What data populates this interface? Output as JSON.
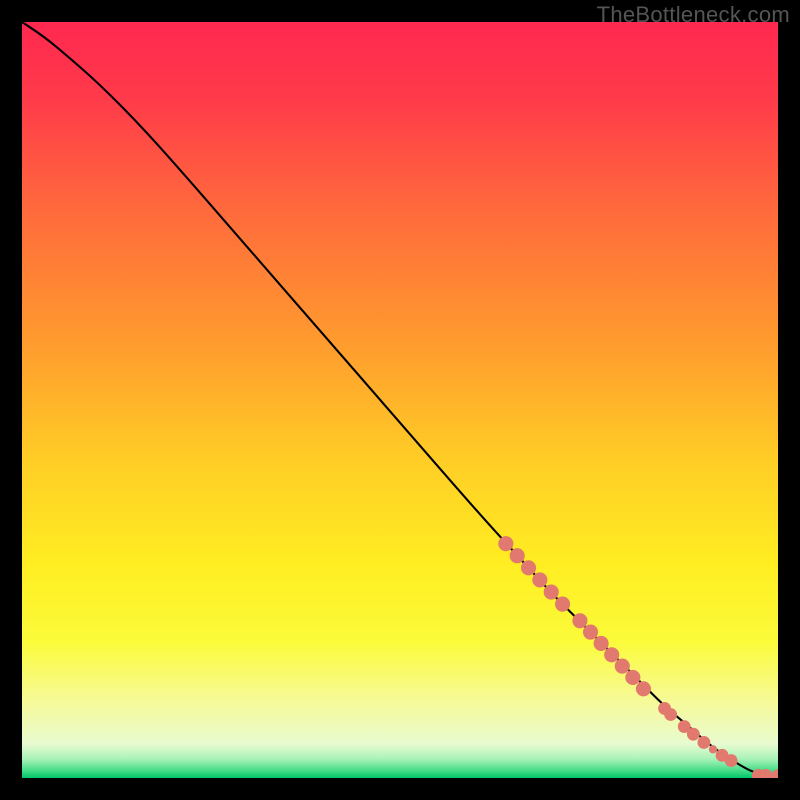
{
  "watermark": "TheBottleneck.com",
  "gradient": {
    "stops": [
      {
        "offset": 0.0,
        "color": "#ff2850"
      },
      {
        "offset": 0.1,
        "color": "#ff3a4a"
      },
      {
        "offset": 0.25,
        "color": "#ff6a3c"
      },
      {
        "offset": 0.42,
        "color": "#ff9a2e"
      },
      {
        "offset": 0.58,
        "color": "#ffcd26"
      },
      {
        "offset": 0.72,
        "color": "#ffee22"
      },
      {
        "offset": 0.82,
        "color": "#fbfb3a"
      },
      {
        "offset": 0.9,
        "color": "#f6fa9a"
      },
      {
        "offset": 0.955,
        "color": "#e8fbd0"
      },
      {
        "offset": 0.975,
        "color": "#a8f2b8"
      },
      {
        "offset": 0.99,
        "color": "#46dd88"
      },
      {
        "offset": 1.0,
        "color": "#00c46a"
      }
    ]
  },
  "chart_data": {
    "type": "line",
    "title": "",
    "xlabel": "",
    "ylabel": "",
    "xlim": [
      0,
      100
    ],
    "ylim": [
      0,
      100
    ],
    "series": [
      {
        "name": "curve",
        "x": [
          0,
          3,
          6,
          10,
          15,
          20,
          30,
          40,
          50,
          60,
          65,
          70,
          73,
          76,
          79,
          82,
          85,
          88,
          90,
          92,
          94,
          95.5,
          96.5,
          97.5,
          98.5,
          100
        ],
        "y": [
          100,
          98,
          95.5,
          92,
          87,
          81.5,
          70,
          58.5,
          47,
          35.5,
          30,
          24.5,
          21.5,
          18.5,
          15.5,
          12.5,
          9.5,
          7,
          5.2,
          3.6,
          2.3,
          1.4,
          0.9,
          0.55,
          0.35,
          0.3
        ],
        "color": "#000000",
        "width": 2
      }
    ],
    "markers": [
      {
        "x": 64.0,
        "y": 31.0,
        "r": 1.0
      },
      {
        "x": 65.5,
        "y": 29.4,
        "r": 1.0
      },
      {
        "x": 67.0,
        "y": 27.8,
        "r": 1.0
      },
      {
        "x": 68.5,
        "y": 26.2,
        "r": 1.0
      },
      {
        "x": 70.0,
        "y": 24.6,
        "r": 1.0
      },
      {
        "x": 71.5,
        "y": 23.0,
        "r": 1.0
      },
      {
        "x": 73.8,
        "y": 20.8,
        "r": 1.0
      },
      {
        "x": 75.2,
        "y": 19.3,
        "r": 1.0
      },
      {
        "x": 76.6,
        "y": 17.8,
        "r": 1.0
      },
      {
        "x": 78.0,
        "y": 16.3,
        "r": 1.0
      },
      {
        "x": 79.4,
        "y": 14.8,
        "r": 1.0
      },
      {
        "x": 80.8,
        "y": 13.3,
        "r": 1.0
      },
      {
        "x": 82.2,
        "y": 11.8,
        "r": 1.0
      },
      {
        "x": 85.0,
        "y": 9.2,
        "r": 0.85
      },
      {
        "x": 85.8,
        "y": 8.4,
        "r": 0.85
      },
      {
        "x": 87.6,
        "y": 6.8,
        "r": 0.85
      },
      {
        "x": 88.8,
        "y": 5.8,
        "r": 0.85
      },
      {
        "x": 90.2,
        "y": 4.7,
        "r": 0.85
      },
      {
        "x": 91.4,
        "y": 3.8,
        "r": 0.55
      },
      {
        "x": 92.6,
        "y": 3.0,
        "r": 0.85
      },
      {
        "x": 93.8,
        "y": 2.3,
        "r": 0.85
      },
      {
        "x": 97.4,
        "y": 0.35,
        "r": 0.85
      },
      {
        "x": 98.4,
        "y": 0.35,
        "r": 0.85
      },
      {
        "x": 100.0,
        "y": 0.3,
        "r": 0.85
      }
    ],
    "marker_color": "#e2796e"
  }
}
